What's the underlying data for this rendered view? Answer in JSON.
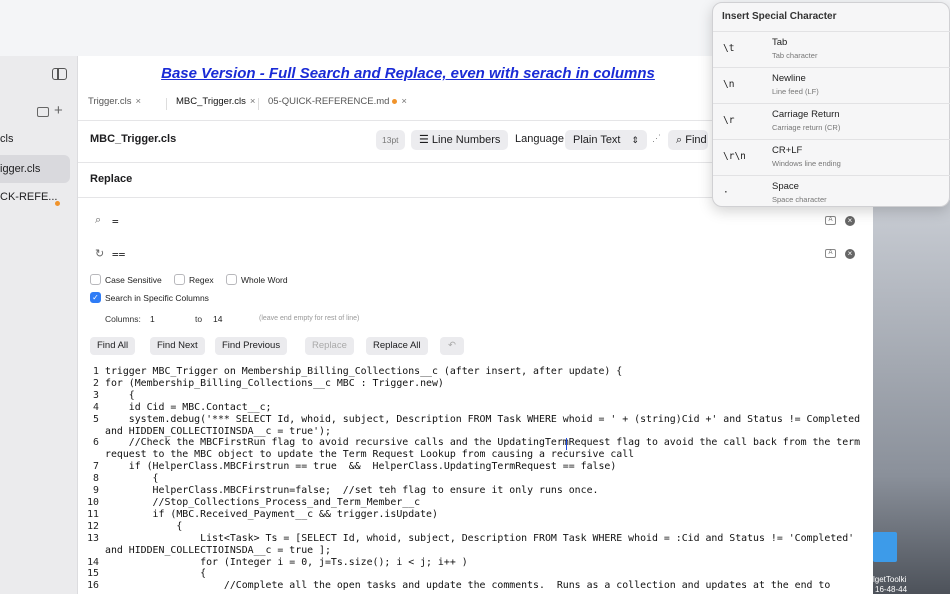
{
  "sidebar": {
    "items": [
      {
        "label": "cls"
      },
      {
        "label": "igger.cls"
      },
      {
        "label": "CK-REFE..."
      }
    ]
  },
  "banner": "Base Version - Full Search and Replace, even with serach in columns",
  "tabs": [
    {
      "label": "Trigger.cls"
    },
    {
      "label": "MBC_Trigger.cls"
    },
    {
      "label": "05-QUICK-REFERENCE.md"
    }
  ],
  "toolbar": {
    "file_title": "MBC_Trigger.cls",
    "font_size": "13pt",
    "line_numbers": "Line Numbers",
    "language_label": "Language",
    "language_value": "Plain Text",
    "find_label": "Find"
  },
  "replace_panel": {
    "title": "Replace",
    "search_value": "=",
    "replace_value": "==",
    "options": {
      "case_sensitive": "Case Sensitive",
      "regex": "Regex",
      "whole_word": "Whole Word",
      "search_columns": "Search in Specific Columns"
    },
    "columns_label": "Columns:",
    "col_from": "1",
    "to_label": "to",
    "col_to": "14",
    "hint": "(leave end empty for rest of line)",
    "buttons": {
      "find_all": "Find All",
      "find_next": "Find Next",
      "find_previous": "Find Previous",
      "replace": "Replace",
      "replace_all": "Replace All"
    }
  },
  "code_lines": [
    {
      "n": "1",
      "t": "trigger MBC_Trigger on Membership_Billing_Collections__c (after insert, after update) {"
    },
    {
      "n": "2",
      "t": "for (Membership_Billing_Collections__c MBC : Trigger.new)"
    },
    {
      "n": "3",
      "t": "    {"
    },
    {
      "n": "4",
      "t": "    id Cid = MBC.Contact__c;"
    },
    {
      "n": "5",
      "t": "    system.debug('*** SELECT Id, whoid, subject, Description FROM Task WHERE whoid = ' + (string)Cid +' and Status != Completed"
    },
    {
      "n": "",
      "t": "and HIDDEN_COLLECTIOINSDA__c = true');"
    },
    {
      "n": "6",
      "t": "    //Check the MBCFirstRun flag to avoid recursive calls and the UpdatingTermRequest flag to avoid the call back from the term"
    },
    {
      "n": "",
      "t": "request to the MBC object to update the Term Request Lookup from causing a recursive call"
    },
    {
      "n": "7",
      "t": "    if (HelperClass.MBCFirstrun == true  &&  HelperClass.UpdatingTermRequest == false)"
    },
    {
      "n": "8",
      "t": "        {"
    },
    {
      "n": "9",
      "t": "        HelperClass.MBCFirstrun=false;  //set teh flag to ensure it only runs once."
    },
    {
      "n": "10",
      "t": "        //Stop_Collections_Process_and_Term_Member__c"
    },
    {
      "n": "11",
      "t": "        if (MBC.Received_Payment__c && trigger.isUpdate)"
    },
    {
      "n": "12",
      "t": "            {"
    },
    {
      "n": "13",
      "t": "                List<Task> Ts = [SELECT Id, whoid, subject, Description FROM Task WHERE whoid = :Cid and Status != 'Completed'"
    },
    {
      "n": "",
      "t": "and HIDDEN_COLLECTIOINSDA__c = true ];"
    },
    {
      "n": "14",
      "t": "                for (Integer i = 0, j=Ts.size(); i < j; i++ )"
    },
    {
      "n": "15",
      "t": "                {"
    },
    {
      "n": "16",
      "t": "                    //Complete all the open tasks and update the comments.  Runs as a collection and updates at the end to"
    }
  ],
  "popup": {
    "title": "Insert Special Character",
    "rows": [
      {
        "code": "\\t",
        "name": "Tab",
        "desc": "Tab character"
      },
      {
        "code": "\\n",
        "name": "Newline",
        "desc": "Line feed (LF)"
      },
      {
        "code": "\\r",
        "name": "Carriage Return",
        "desc": "Carriage return (CR)"
      },
      {
        "code": "\\r\\n",
        "name": "CR+LF",
        "desc": "Windows line ending"
      },
      {
        "code": "·",
        "name": "Space",
        "desc": "Space character"
      }
    ]
  },
  "desktop": {
    "label1": "lgetToolki",
    "label2": "16-48-44"
  }
}
